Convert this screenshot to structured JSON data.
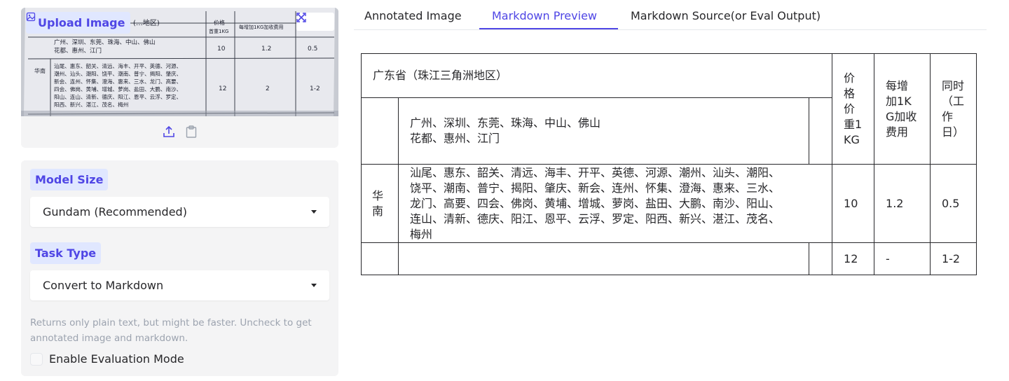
{
  "upload": {
    "label": "Upload Image"
  },
  "image_preview": {
    "header_region": "(…地区)",
    "col_price": "价格",
    "col_first_weight": "首重1KG",
    "col_each_extra": "每增加1KG加收费用",
    "row1_cities": "广州、深圳、东莞、珠海、中山、佛山",
    "row1_cities2": "花都、惠州、江门",
    "row1_price": "10",
    "row1_extra": "1.2",
    "row1_days": "0.5",
    "row_label": "华南",
    "row2_line1": "汕尾、惠东、韶关、清远、海丰、开平、英德、河源、",
    "row2_line2": "潮州、汕头、潮阳、饶平、潮南、普宁、揭阳、肇庆、",
    "row2_line3": "新会、连州、怀集、澄海、惠来、三水、龙门、高要、",
    "row2_line4": "四会、佛岗、黄埔、增城、萝岗、盐田、大鹏、南沙、",
    "row2_line5": "阳山、连山、清新、德庆、阳江、恩平、云浮、罗定、",
    "row2_line6": "阳西、新兴、湛江、茂名、梅州",
    "row2_price": "12",
    "row2_extra": "2",
    "row2_days": "1-2"
  },
  "settings": {
    "model_size_label": "Model Size",
    "model_size_value": "Gundam (Recommended)",
    "task_type_label": "Task Type",
    "task_type_value": "Convert to Markdown",
    "info": "Returns only plain text, but might be faster. Uncheck to get annotated image and markdown.",
    "eval_label": "Enable Evaluation Mode"
  },
  "tabs": [
    {
      "label": "Annotated Image"
    },
    {
      "label": "Markdown Preview"
    },
    {
      "label": "Markdown Source(or Eval Output)"
    }
  ],
  "table": {
    "region_header": "广东省（珠江三角洲地区）",
    "price_header": "价格价重1KG",
    "extra_header": "每增加1KG加收费用",
    "days_header": "同时（工作日）",
    "row1_cities": "广州、深圳、东莞、珠海、中山、佛山",
    "row1_cities2": "花都、惠州、江门",
    "row2_region": "华南",
    "row2_cities": "汕尾、惠东、韶关、清远、海丰、开平、英德、河源、潮州、汕头、潮阳、饶平、潮南、普宁、揭阳、肇庆、新会、连州、怀集、澄海、惠来、三水、龙门、高要、四会、佛岗、黄埔、增城、萝岗、盐田、大鹏、南沙、阳山、连山、清新、德庆、阳江、恩平、云浮、罗定、阳西、新兴、湛江、茂名、梅州",
    "row2_price": "10",
    "row2_extra": "1.2",
    "row2_days": "0.5",
    "row3_price": "12",
    "row3_extra": "-",
    "row3_days": "1-2"
  },
  "colors": {
    "accent": "#4f46e5",
    "accent_bg": "#e0e7ff",
    "panel_bg": "#f4f4f5",
    "muted_text": "#9ca3af"
  }
}
